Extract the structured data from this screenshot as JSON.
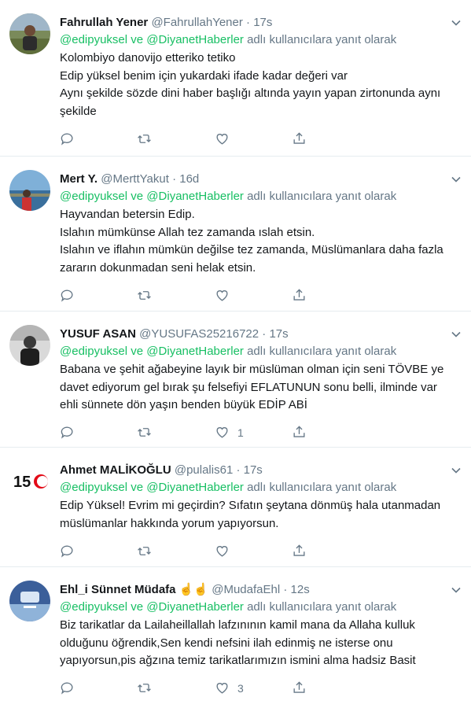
{
  "reply_prefix_label": "adlı kullanıcılara yanıt olarak",
  "tweets": [
    {
      "name": "Fahrullah Yener",
      "handle": "@FahrullahYener",
      "time": "17s",
      "mention1": "@edipyuksel",
      "joiner": "ve",
      "mention2": "@DiyanetHaberler",
      "lines": [
        "Kolombiyo danovijo etteriko tetiko",
        "Edip yüksel benim için yukardaki ifade kadar değeri var",
        "Aynı şekilde sözde dini haber başlığı altında yayın yapan zirtonunda aynı",
        "şekilde"
      ],
      "like_count": ""
    },
    {
      "name": "Mert Y.",
      "handle": "@MerttYakut",
      "time": "16d",
      "mention1": "@edipyuksel",
      "joiner": "ve",
      "mention2": "@DiyanetHaberler",
      "lines": [
        "Hayvandan betersin Edip.",
        "Islahın mümkünse Allah tez zamanda ıslah etsin.",
        "Islahın ve iflahın mümkün değilse tez zamanda, Müslümanlara daha fazla",
        "zararın dokunmadan seni helak etsin."
      ],
      "like_count": ""
    },
    {
      "name": "YUSUF ASAN",
      "handle": "@YUSUFAS25216722",
      "time": "17s",
      "mention1": "@edipyuksel",
      "joiner": "ve",
      "mention2": "@DiyanetHaberler",
      "lines": [
        "Babana ve  şehit ağabeyine layık bir müslüman olman için seni TÖVBE ye",
        "davet ediyorum gel bırak şu felsefiyi EFLATUNUN sonu belli, ilminde var",
        "ehli sünnete dön yaşın benden büyük EDİP ABİ"
      ],
      "like_count": "1"
    },
    {
      "name": "Ahmet MALİKOĞLU",
      "handle": "@pulalis61",
      "time": "17s",
      "mention1": "@edipyuksel",
      "joiner": "ve",
      "mention2": "@DiyanetHaberler",
      "lines": [
        "Edip Yüksel! Evrim mi geçirdin? Sıfatın şeytana dönmüş hala utanmadan",
        "müslümanlar hakkında yorum yapıyorsun."
      ],
      "like_count": ""
    },
    {
      "name": "Ehl_i Sünnet Müdafa",
      "handle": "@MudafaEhl",
      "time": "12s",
      "emoji": "☝️☝️",
      "mention1": "@edipyuksel",
      "joiner": "ve",
      "mention2": "@DiyanetHaberler",
      "lines": [
        "Biz tarikatlar da Lailaheillallah lafzınının kamil mana da Allaha kulluk",
        "olduğunu öğrendik,Sen kendi nefsini ilah edinmiş ne isterse onu",
        "yapıyorsun,pis ağzına temiz tarikatlarımızın ismini alma hadsiz Basit"
      ],
      "reply_count": "",
      "like_count": "3"
    }
  ],
  "avatar4_text": "15",
  "colors": {
    "mention": "#17bf63",
    "muted": "#657786",
    "text": "#14171a",
    "divider": "#e6ecf0"
  }
}
